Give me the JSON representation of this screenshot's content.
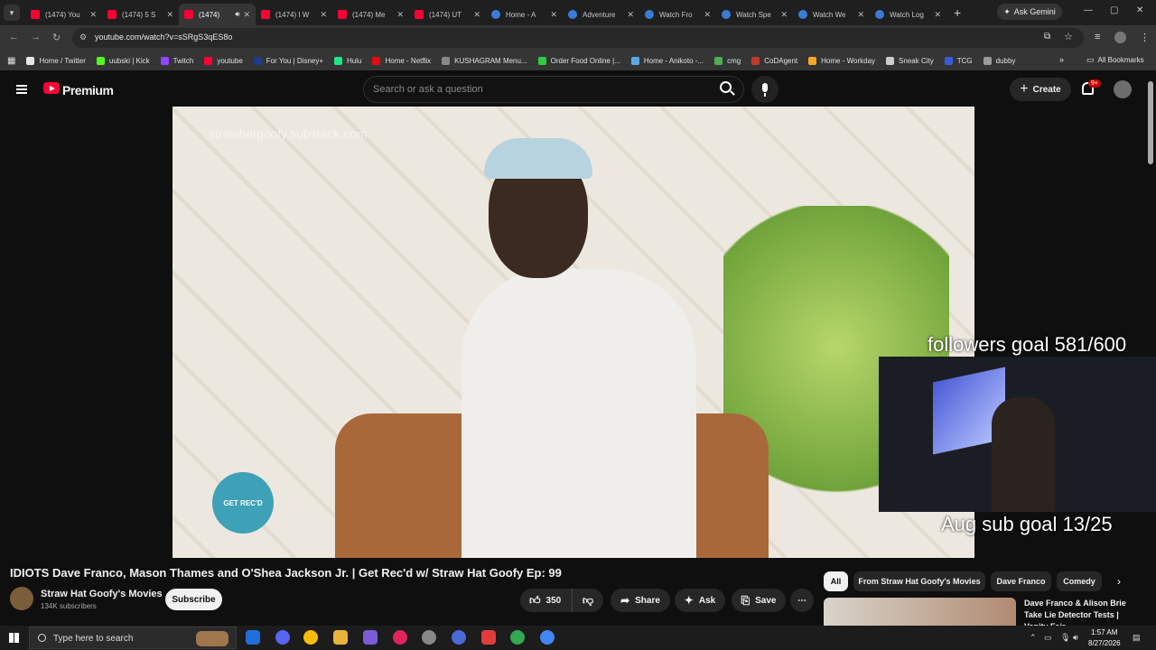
{
  "browser": {
    "tabs": [
      {
        "title": "(1474) You",
        "icon": "youtube-icon",
        "active": false
      },
      {
        "title": "(1474) 5 S",
        "icon": "youtube-icon",
        "active": false
      },
      {
        "title": "(1474)",
        "icon": "youtube-icon",
        "active": true
      },
      {
        "title": "(1474) I W",
        "icon": "youtube-icon",
        "active": false
      },
      {
        "title": "(1474) Me",
        "icon": "youtube-icon",
        "active": false
      },
      {
        "title": "(1474) UT",
        "icon": "youtube-icon",
        "active": false
      },
      {
        "title": "Home - A",
        "icon": "globe-icon",
        "active": false
      },
      {
        "title": "Adventure",
        "icon": "globe-icon",
        "active": false
      },
      {
        "title": "Watch Fro",
        "icon": "globe-icon",
        "active": false
      },
      {
        "title": "Watch Spe",
        "icon": "globe-icon",
        "active": false
      },
      {
        "title": "Watch We",
        "icon": "globe-icon",
        "active": false
      },
      {
        "title": "Watch Log",
        "icon": "globe-icon",
        "active": false
      }
    ],
    "ask_gemini": "Ask Gemini",
    "url": "youtube.com/watch?v=sSRgS3qES8o",
    "bookmarks": [
      {
        "label": "Home / Twitter",
        "color": "#e7e7e7"
      },
      {
        "label": "uubski | Kick",
        "color": "#53fc18"
      },
      {
        "label": "Twitch",
        "color": "#9146ff"
      },
      {
        "label": "youtube",
        "color": "#ff0033"
      },
      {
        "label": "For You | Disney+",
        "color": "#1f3b8c"
      },
      {
        "label": "Hulu",
        "color": "#1ce783"
      },
      {
        "label": "Home - Netflix",
        "color": "#e50914"
      },
      {
        "label": "KUSHAGRAM Menu...",
        "color": "#888888"
      },
      {
        "label": "Order Food Online |...",
        "color": "#2ecc40"
      },
      {
        "label": "Home - Anikoto -...",
        "color": "#5aa9e6"
      },
      {
        "label": "cmg",
        "color": "#4caf50"
      },
      {
        "label": "CoDAgent",
        "color": "#c0392b"
      },
      {
        "label": "Home - Workday",
        "color": "#f5a623"
      },
      {
        "label": "Sneak City",
        "color": "#cccccc"
      },
      {
        "label": "TCG",
        "color": "#3b5bdb"
      },
      {
        "label": "dubby",
        "color": "#999999"
      }
    ],
    "all_bookmarks": "All Bookmarks"
  },
  "youtube": {
    "brand": "Premium",
    "search_placeholder": "Search or ask a question",
    "create_label": "Create",
    "notification_badge": "9+"
  },
  "video": {
    "watermark": "strawhatgoofy.substack.com",
    "logo_text": "GET REC'D",
    "overlay_followers": "followers goal 581/600",
    "overlay_subs": "Aug sub goal 13/25",
    "title": "IDIOTS Dave Franco, Mason Thames and O'Shea Jackson Jr. | Get Rec'd w/ Straw Hat Goofy Ep: 99",
    "channel_name": "Straw Hat Goofy's Movies",
    "subscribers": "134K subscribers",
    "subscribe_label": "Subscribe",
    "likes": "350",
    "share_label": "Share",
    "ask_label": "Ask",
    "save_label": "Save"
  },
  "chips": [
    "All",
    "From Straw Hat Goofy's Movies",
    "Dave Franco",
    "Comedy"
  ],
  "recommendation": {
    "title": "Dave Franco & Alison Brie Take Lie Detector Tests | Vanity Fair"
  },
  "taskbar": {
    "search_placeholder": "Type here to search",
    "time": "1:57 AM",
    "date": "8/27/2026"
  }
}
